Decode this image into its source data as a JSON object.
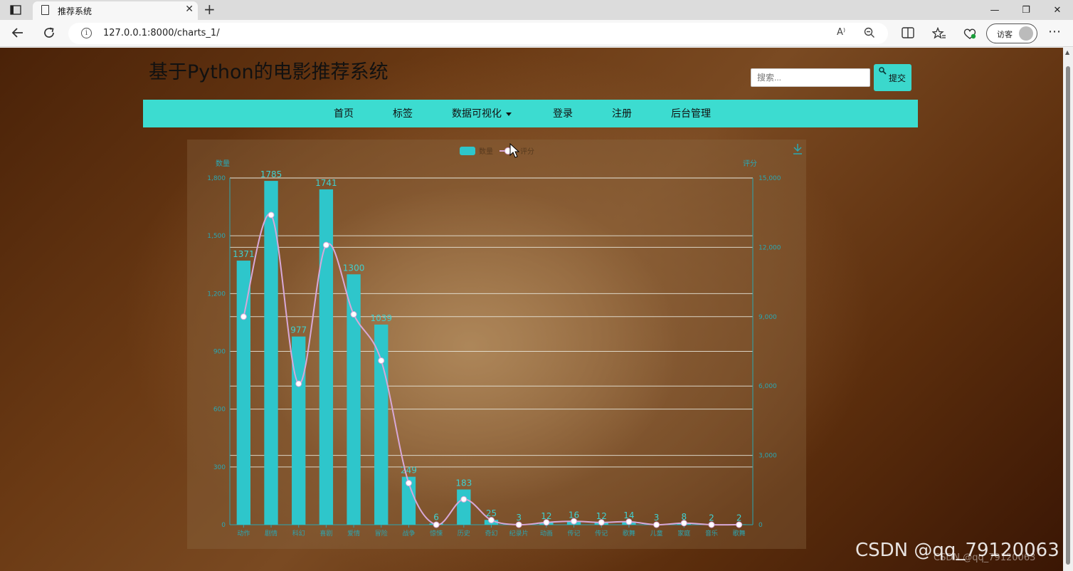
{
  "browser": {
    "tab_title": "推荐系统",
    "tab_close": "✕",
    "new_tab": "+",
    "url": "127.0.0.1:8000/charts_1/",
    "visitor_label": "访客",
    "window_controls": {
      "minimize": "—",
      "restore": "❐",
      "close": "✕"
    },
    "icons": [
      "sidebar-icon",
      "page-icon",
      "back-icon",
      "refresh-icon",
      "info-icon",
      "read-aloud-icon",
      "zoom-icon",
      "split-screen-icon",
      "favorites-icon",
      "extensions-icon",
      "more-icon"
    ]
  },
  "site": {
    "title": "基于Python的电影推荐系统",
    "search_placeholder": "搜索...",
    "search_button": "提交"
  },
  "nav": {
    "items": [
      "首页",
      "标签",
      "数据可视化",
      "登录",
      "注册",
      "后台管理"
    ]
  },
  "chart_data": {
    "type": "bar",
    "legend": [
      "数量",
      "评分"
    ],
    "ylabel_left": "数量",
    "ylabel_right": "评分",
    "categories": [
      "动作",
      "剧情",
      "科幻",
      "喜剧",
      "爱情",
      "冒险",
      "战争",
      "惊悚",
      "历史",
      "奇幻",
      "纪录片",
      "动画",
      "传记",
      "传记",
      "歌舞",
      "儿童",
      "家庭",
      "音乐",
      "歌舞"
    ],
    "series": [
      {
        "name": "数量",
        "type": "bar",
        "axis": "left",
        "color": "#2ec6cb",
        "values": [
          1371,
          1785,
          977,
          1741,
          1300,
          1039,
          249,
          6,
          183,
          25,
          3,
          12,
          16,
          12,
          14,
          3,
          8,
          2,
          2
        ]
      },
      {
        "name": "评分",
        "type": "line",
        "axis": "right",
        "color": "#d8a8d8",
        "values": [
          9000,
          13400,
          6100,
          12100,
          9100,
          7100,
          1800,
          0,
          1100,
          200,
          0,
          100,
          150,
          100,
          130,
          0,
          70,
          0,
          0
        ]
      }
    ],
    "ylim_left": [
      0,
      1800
    ],
    "yticks_left": [
      "0",
      "300",
      "600",
      "900",
      "1,200",
      "1,500",
      "1,800"
    ],
    "ylim_right": [
      0,
      15000
    ],
    "yticks_right": [
      "0",
      "3,000",
      "6,000",
      "9,000",
      "12,000",
      "15,000"
    ],
    "grid": true,
    "legend_position": "top-center"
  },
  "watermark": "CSDN @qq_79120063"
}
